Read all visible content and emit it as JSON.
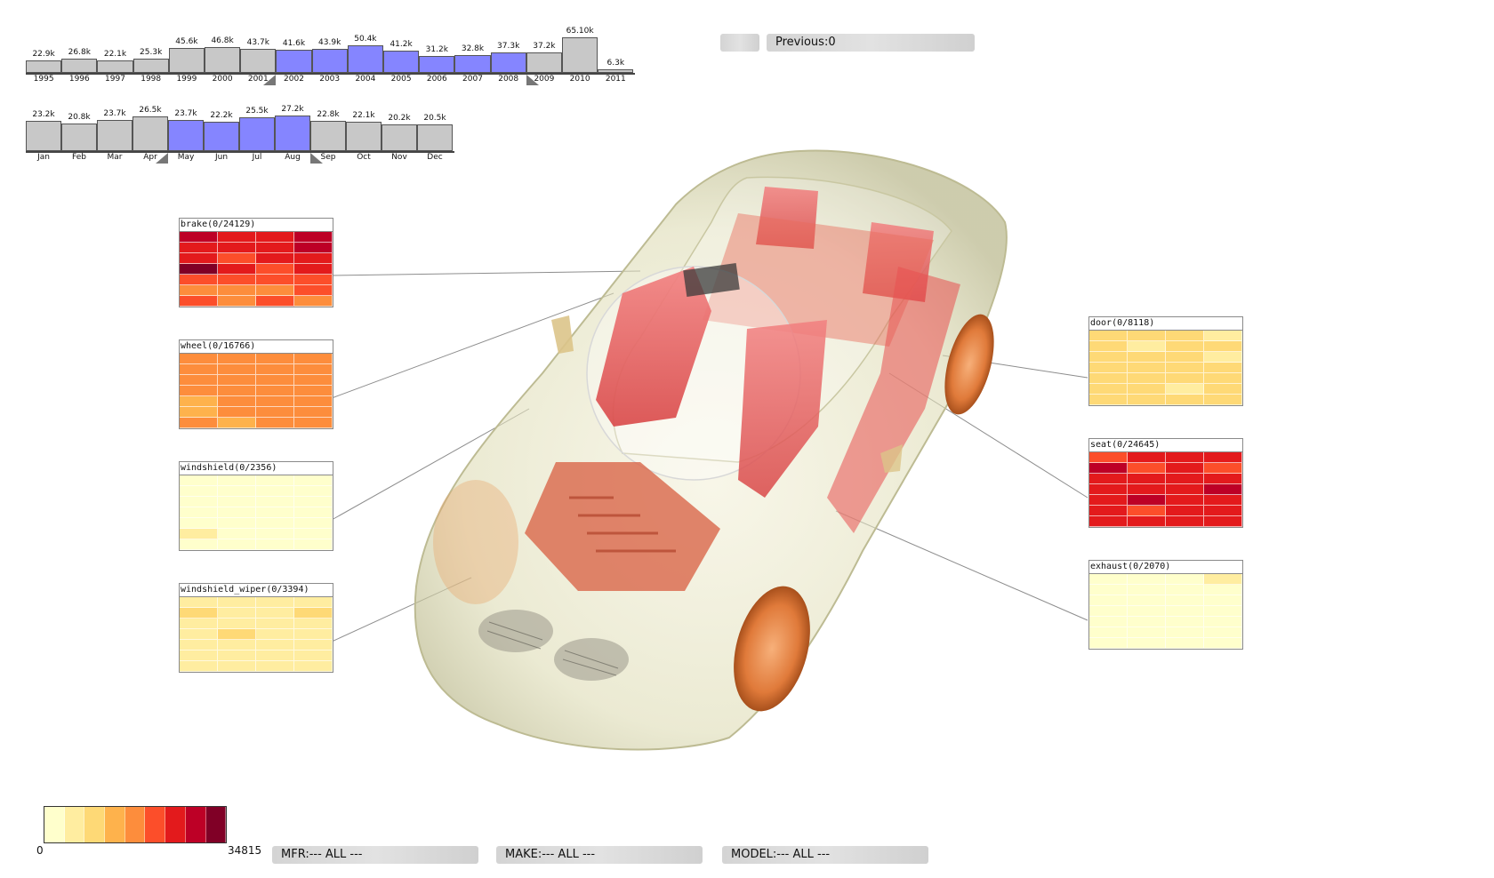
{
  "year_chart": {
    "bars": [
      {
        "label": "1995",
        "value_label": "22.9k",
        "value": 22.9,
        "selected": false
      },
      {
        "label": "1996",
        "value_label": "26.8k",
        "value": 26.8,
        "selected": false
      },
      {
        "label": "1997",
        "value_label": "22.1k",
        "value": 22.1,
        "selected": false
      },
      {
        "label": "1998",
        "value_label": "25.3k",
        "value": 25.3,
        "selected": false
      },
      {
        "label": "1999",
        "value_label": "45.6k",
        "value": 45.6,
        "selected": false
      },
      {
        "label": "2000",
        "value_label": "46.8k",
        "value": 46.8,
        "selected": false
      },
      {
        "label": "2001",
        "value_label": "43.7k",
        "value": 43.7,
        "selected": false
      },
      {
        "label": "2002",
        "value_label": "41.6k",
        "value": 41.6,
        "selected": true
      },
      {
        "label": "2003",
        "value_label": "43.9k",
        "value": 43.9,
        "selected": true
      },
      {
        "label": "2004",
        "value_label": "50.4k",
        "value": 50.4,
        "selected": true
      },
      {
        "label": "2005",
        "value_label": "41.2k",
        "value": 41.2,
        "selected": true
      },
      {
        "label": "2006",
        "value_label": "31.2k",
        "value": 31.2,
        "selected": true
      },
      {
        "label": "2007",
        "value_label": "32.8k",
        "value": 32.8,
        "selected": true
      },
      {
        "label": "2008",
        "value_label": "37.3k",
        "value": 37.3,
        "selected": true
      },
      {
        "label": "2009",
        "value_label": "37.2k",
        "value": 37.2,
        "selected": false
      },
      {
        "label": "2010",
        "value_label": "65.10k",
        "value": 65.1,
        "selected": false
      },
      {
        "label": "2011",
        "value_label": "6.3k",
        "value": 6.3,
        "selected": false
      }
    ]
  },
  "month_chart": {
    "bars": [
      {
        "label": "Jan",
        "value_label": "23.2k",
        "value": 23.2,
        "selected": false
      },
      {
        "label": "Feb",
        "value_label": "20.8k",
        "value": 20.8,
        "selected": false
      },
      {
        "label": "Mar",
        "value_label": "23.7k",
        "value": 23.7,
        "selected": false
      },
      {
        "label": "Apr",
        "value_label": "26.5k",
        "value": 26.5,
        "selected": false
      },
      {
        "label": "May",
        "value_label": "23.7k",
        "value": 23.7,
        "selected": true
      },
      {
        "label": "Jun",
        "value_label": "22.2k",
        "value": 22.2,
        "selected": true
      },
      {
        "label": "Jul",
        "value_label": "25.5k",
        "value": 25.5,
        "selected": true
      },
      {
        "label": "Aug",
        "value_label": "27.2k",
        "value": 27.2,
        "selected": true
      },
      {
        "label": "Sep",
        "value_label": "22.8k",
        "value": 22.8,
        "selected": false
      },
      {
        "label": "Oct",
        "value_label": "22.1k",
        "value": 22.1,
        "selected": false
      },
      {
        "label": "Nov",
        "value_label": "20.2k",
        "value": 20.2,
        "selected": false
      },
      {
        "label": "Dec",
        "value_label": "20.5k",
        "value": 20.5,
        "selected": false
      }
    ]
  },
  "colors": {
    "selected_bar": "#8585ff",
    "unselected_bar": "#c8c8c8",
    "scale": [
      "#ffffcc",
      "#ffeda0",
      "#fed976",
      "#feb24c",
      "#fd8d3c",
      "#fc4e2a",
      "#e31a1c",
      "#bd0026",
      "#800026"
    ]
  },
  "toolbar": {
    "blank_button": "",
    "previous_label": "Previous:0"
  },
  "panels_left": [
    {
      "title": "brake(0/24129)",
      "levels": [
        [
          7,
          6,
          6,
          7
        ],
        [
          6,
          6,
          6,
          7
        ],
        [
          6,
          5,
          6,
          6
        ],
        [
          8,
          6,
          5,
          6
        ],
        [
          5,
          5,
          5,
          5
        ],
        [
          4,
          4,
          4,
          5
        ],
        [
          5,
          4,
          5,
          4
        ]
      ]
    },
    {
      "title": "wheel(0/16766)",
      "levels": [
        [
          4,
          4,
          4,
          4
        ],
        [
          4,
          4,
          4,
          4
        ],
        [
          4,
          4,
          4,
          4
        ],
        [
          4,
          4,
          4,
          4
        ],
        [
          3,
          4,
          4,
          4
        ],
        [
          3,
          4,
          4,
          4
        ],
        [
          4,
          3,
          4,
          4
        ]
      ]
    },
    {
      "title": "windshield(0/2356)",
      "levels": [
        [
          0,
          0,
          0,
          0
        ],
        [
          0,
          0,
          0,
          0
        ],
        [
          0,
          0,
          0,
          0
        ],
        [
          0,
          0,
          0,
          0
        ],
        [
          0,
          0,
          0,
          0
        ],
        [
          1,
          0,
          0,
          0
        ],
        [
          0,
          0,
          0,
          0
        ]
      ]
    },
    {
      "title": "windshield_wiper(0/3394)",
      "levels": [
        [
          1,
          1,
          1,
          1
        ],
        [
          2,
          1,
          1,
          2
        ],
        [
          1,
          1,
          1,
          1
        ],
        [
          1,
          2,
          1,
          1
        ],
        [
          1,
          1,
          1,
          1
        ],
        [
          1,
          1,
          1,
          1
        ],
        [
          1,
          1,
          1,
          1
        ]
      ]
    }
  ],
  "panels_right": [
    {
      "title": "door(0/8118)",
      "levels": [
        [
          2,
          2,
          2,
          1
        ],
        [
          2,
          1,
          2,
          2
        ],
        [
          2,
          2,
          2,
          1
        ],
        [
          2,
          2,
          2,
          2
        ],
        [
          2,
          2,
          2,
          2
        ],
        [
          2,
          2,
          1,
          2
        ],
        [
          2,
          2,
          2,
          2
        ]
      ]
    },
    {
      "title": "seat(0/24645)",
      "levels": [
        [
          5,
          6,
          6,
          6
        ],
        [
          7,
          5,
          6,
          5
        ],
        [
          6,
          6,
          6,
          6
        ],
        [
          6,
          6,
          6,
          7
        ],
        [
          6,
          7,
          6,
          6
        ],
        [
          6,
          5,
          6,
          6
        ],
        [
          6,
          6,
          6,
          6
        ]
      ]
    },
    {
      "title": "exhaust(0/2070)",
      "levels": [
        [
          0,
          0,
          0,
          1
        ],
        [
          0,
          0,
          0,
          0
        ],
        [
          0,
          0,
          0,
          0
        ],
        [
          0,
          0,
          0,
          0
        ],
        [
          0,
          0,
          0,
          0
        ],
        [
          0,
          0,
          0,
          0
        ],
        [
          0,
          0,
          0,
          0
        ]
      ]
    }
  ],
  "legend": {
    "min_label": "0",
    "max_label": "34815"
  },
  "filters": {
    "mfr": "MFR:--- ALL ---",
    "make": "MAKE:--- ALL ---",
    "model": "MODEL:--- ALL ---"
  }
}
